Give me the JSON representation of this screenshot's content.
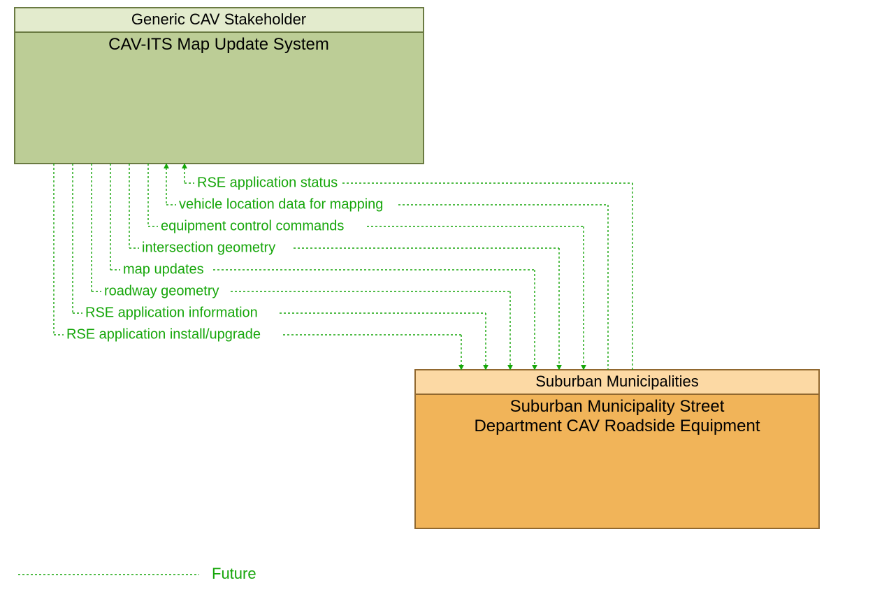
{
  "boxes": {
    "top": {
      "header": "Generic CAV Stakeholder",
      "body": "CAV-ITS Map Update System",
      "headerFill": "#e3ebcd",
      "bodyFill": "#bccd96",
      "stroke": "#6a7a42"
    },
    "bottom": {
      "header": "Suburban Municipalities",
      "body_line1": "Suburban Municipality Street",
      "body_line2": "Department CAV Roadside Equipment",
      "headerFill": "#fcd9a4",
      "bodyFill": "#f1b459",
      "stroke": "#91682f"
    }
  },
  "flows": {
    "f1": "RSE application status",
    "f2": "vehicle location data for mapping",
    "f3": "equipment control commands",
    "f4": "intersection geometry",
    "f5": "map updates",
    "f6": "roadway geometry",
    "f7": "RSE application information",
    "f8": "RSE application install/upgrade"
  },
  "legend": "Future",
  "colors": {
    "flowLine": "#16a60a"
  }
}
